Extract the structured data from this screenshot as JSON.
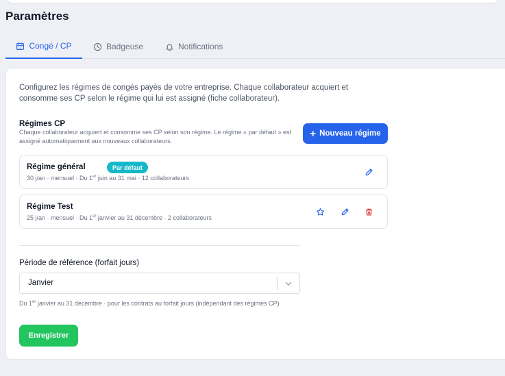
{
  "page": {
    "title": "Paramètres"
  },
  "tabs": [
    {
      "label": "Congé / CP",
      "icon": "calendar-icon",
      "active": true
    },
    {
      "label": "Badgeuse",
      "icon": "clock-icon"
    },
    {
      "label": "Notifications",
      "icon": "bell-icon"
    }
  ],
  "intro": "Configurez les régimes de congés payés de votre entreprise. Chaque collaborateur acquiert et consomme ses CP selon le régime qui lui est assigné (fiche collaborateur).",
  "regimes_section": {
    "title": "Régimes CP",
    "description": "Chaque collaborateur acquiert et consomme ses CP selon son régime. Le régime « par défaut » est assigné automatiquement aux nouveaux collaborateurs.",
    "new_button": "Nouveau régime"
  },
  "regimes": [
    {
      "name": "Régime général",
      "badge": "Par défaut",
      "meta_prefix": "30 j/an · mensuel · Du 1",
      "meta_sup": "er",
      "meta_suffix": " juin au 31 mai · 12 collaborateurs"
    },
    {
      "name": "Régime Test",
      "meta_prefix": "25 j/an · mensuel · Du 1",
      "meta_sup": "er",
      "meta_suffix": " janvier au 31 décembre · 2 collaborateurs"
    }
  ],
  "reference_period": {
    "label": "Période de référence (forfait jours)",
    "value": "Janvier",
    "hint_prefix": "Du 1",
    "hint_sup": "er",
    "hint_suffix": " janvier au 31 décembre · pour les contrats au forfait jours (indépendant des régimes CP)"
  },
  "save_button": "Enregistrer",
  "colors": {
    "primary": "#2563eb",
    "success": "#22c55e",
    "badge": "#14b8c8",
    "danger": "#dc2626"
  }
}
